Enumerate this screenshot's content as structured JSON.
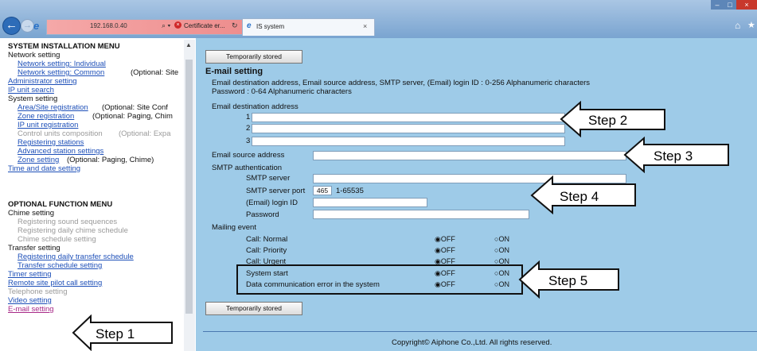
{
  "browser": {
    "address": "192.168.0.40",
    "cert_error": "Certificate er...",
    "tab_title": "IS system",
    "icons": [
      "back-icon",
      "forward-icon",
      "ie-icon",
      "search-icon",
      "certificate-error-icon",
      "refresh-icon",
      "home-icon",
      "favorites-star-icon",
      "close-icon"
    ]
  },
  "sidebar": {
    "system_header": "SYSTEM INSTALLATION MENU",
    "network_setting": "Network setting",
    "network_individual": "Network setting: Individual",
    "network_common": "Network setting: Common",
    "network_common_note": "(Optional: Site",
    "administrator_setting": "Administrator setting",
    "ip_unit_search": "IP unit search",
    "system_setting": "System setting",
    "area_site_registration": "Area/Site registration",
    "area_site_note": "(Optional: Site Conf",
    "zone_registration": "Zone registration",
    "zone_registration_note": "(Optional: Paging, Chim",
    "ip_unit_registration": "IP unit registration",
    "control_units": "Control units composition",
    "control_units_note": "(Optional: Expa",
    "registering_stations": "Registering stations",
    "advanced_station_settings": "Advanced station settings",
    "zone_setting": "Zone setting",
    "zone_setting_note": "(Optional: Paging, Chime)",
    "time_date_setting": "Time and date setting",
    "optional_header": "OPTIONAL FUNCTION MENU",
    "chime_setting": "Chime setting",
    "registering_sound": "Registering sound sequences",
    "registering_daily_chime": "Registering daily chime schedule",
    "chime_schedule_setting": "Chime schedule setting",
    "transfer_setting": "Transfer setting",
    "registering_daily_transfer": "Registering daily transfer schedule",
    "transfer_schedule_setting": "Transfer schedule setting",
    "timer_setting": "Timer setting",
    "remote_site_pilot": "Remote site pilot call setting",
    "telephone_setting": "Telephone setting",
    "video_setting": "Video setting",
    "email_setting": "E-mail setting"
  },
  "main": {
    "temp_stored_label": "Temporarily stored",
    "section_title": "E-mail setting",
    "desc_line1": "Email destination address, Email source address, SMTP server, (Email) login ID : 0-256 Alphanumeric characters",
    "desc_line2": "Password : 0-64 Alphanumeric characters",
    "email_destination_label": "Email destination address",
    "dest_num1": "1",
    "dest_num2": "2",
    "dest_num3": "3",
    "email_source_label": "Email source address",
    "smtp_auth_label": "SMTP authentication",
    "smtp_server_label": "SMTP server",
    "smtp_port_label": "SMTP server port",
    "smtp_port_value": "465",
    "smtp_port_range": "1-65535",
    "login_id_label": "(Email) login ID",
    "password_label": "Password",
    "mailing_event_label": "Mailing event",
    "events": [
      {
        "label": "Call: Normal",
        "off": "OFF",
        "on": "ON",
        "selected": "OFF"
      },
      {
        "label": "Call: Priority",
        "off": "OFF",
        "on": "ON",
        "selected": "OFF"
      },
      {
        "label": "Call: Urgent",
        "off": "OFF",
        "on": "ON",
        "selected": "OFF"
      },
      {
        "label": "System start",
        "off": "OFF",
        "on": "ON",
        "selected": "OFF"
      },
      {
        "label": "Data communication error in the system",
        "off": "OFF",
        "on": "ON",
        "selected": "OFF"
      }
    ],
    "copyright": "Copyright© Aiphone Co.,Ltd. All rights reserved."
  },
  "callouts": {
    "step1": "Step 1",
    "step2": "Step 2",
    "step3": "Step 3",
    "step4": "Step 4",
    "step5": "Step 5"
  }
}
